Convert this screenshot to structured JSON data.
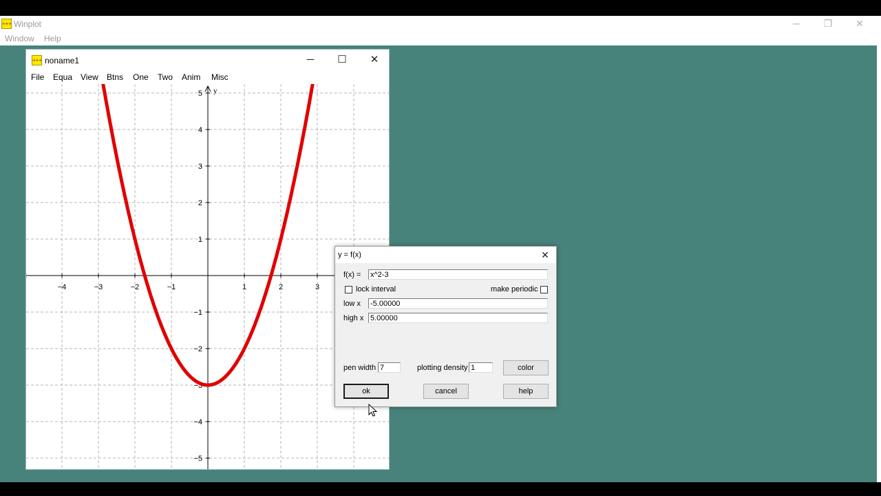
{
  "app": {
    "title": "Winplot",
    "icon_label": "+++",
    "menu": [
      "Window",
      "Help"
    ],
    "controls": {
      "minimize": "─",
      "restore": "❐",
      "close": "✕"
    }
  },
  "child_window": {
    "title": "noname1",
    "icon_label": "+++",
    "menu": [
      "File",
      "Equa",
      "View",
      "Btns",
      "One",
      "Two",
      "Anim",
      "Misc"
    ],
    "controls": {
      "minimize": "─",
      "maximize": "☐",
      "close": "✕"
    }
  },
  "chart_data": {
    "type": "line",
    "function": "x^2-3",
    "xlim": [
      -5,
      5
    ],
    "xticks": [
      -4,
      -3,
      -2,
      -1,
      1,
      2,
      3
    ],
    "yticks": [
      -5,
      -4,
      -3,
      -2,
      -1,
      1,
      2,
      3,
      4,
      5
    ],
    "xlabel": "",
    "ylabel": "y",
    "grid": true,
    "line_color": "#e00000",
    "series": [
      {
        "x": [
          -3,
          -2.5,
          -2,
          -1.5,
          -1,
          -0.5,
          0,
          0.5,
          1,
          1.5,
          2,
          2.5,
          3
        ],
        "y": [
          6,
          3.25,
          1,
          -0.75,
          -2,
          -2.75,
          -3,
          -2.75,
          -2,
          -0.75,
          1,
          3.25,
          6
        ]
      }
    ]
  },
  "dialog": {
    "title": "y = f(x)",
    "close": "✕",
    "fx_label": "f(x) =",
    "fx_value": "x^2-3",
    "lock_interval_label": "lock interval",
    "make_periodic_label": "make periodic",
    "low_x_label": "low x",
    "low_x_value": "-5.00000",
    "high_x_label": "high x",
    "high_x_value": "5.00000",
    "pen_width_label": "pen width",
    "pen_width_value": "7",
    "plotting_density_label": "plotting density",
    "plotting_density_value": "1",
    "color_button": "color",
    "ok_button": "ok",
    "cancel_button": "cancel",
    "help_button": "help"
  }
}
